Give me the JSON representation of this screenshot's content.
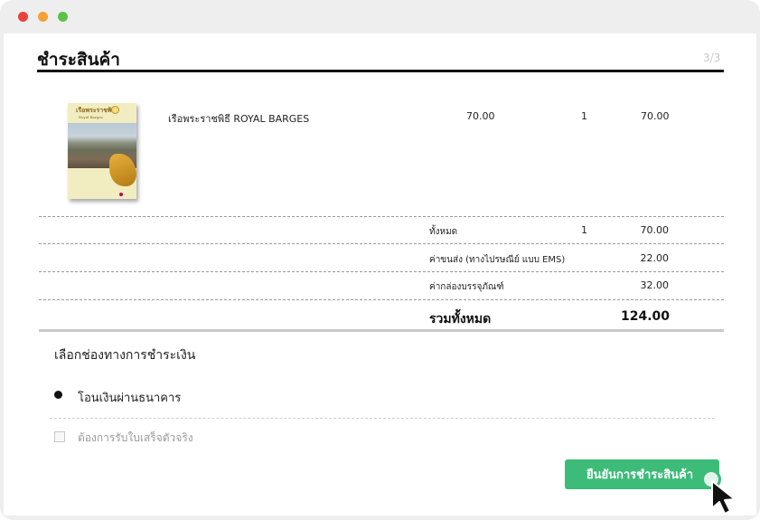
{
  "window": {
    "buttons": [
      "close",
      "minimize",
      "maximize"
    ]
  },
  "page": {
    "title": "ชำระสินค้า",
    "step": "3/3"
  },
  "cart": {
    "items": [
      {
        "image": "book-cover",
        "cover_title": "เรือพระราชพิธี",
        "cover_subtitle": "Royal Barges",
        "name": "เรือพระราชพิธี ROYAL BARGES",
        "price": "70.00",
        "qty": "1",
        "total": "70.00"
      }
    ]
  },
  "summary": {
    "subtotal_label": "ทั้งหมด",
    "subtotal_qty": "1",
    "subtotal_value": "70.00",
    "shipping_label": "ค่าขนส่ง (ทางไปรษณีย์ แบบ EMS)",
    "shipping_value": "22.00",
    "box_label": "ค่ากล่องบรรจุภัณฑ์",
    "box_value": "32.00",
    "grand_label": "รวมทั้งหมด",
    "grand_value": "124.00"
  },
  "payment": {
    "heading": "เลือกช่องทางการชำระเงิน",
    "options": [
      {
        "label": "โอนเงินผ่านธนาคาร",
        "selected": true
      }
    ],
    "receipt_checkbox": {
      "label": "ต้องการรับใบเสร็จตัวจริง",
      "checked": false
    }
  },
  "actions": {
    "confirm_label": "ยืนยันการชำระสินค้า"
  },
  "colors": {
    "accent": "#3dbb79",
    "window_bg": "#eeeeee",
    "close": "#ee3f3a",
    "minimize": "#f4a233",
    "maximize": "#5cc147"
  },
  "icons": {
    "cursor": "arrow-cursor-icon",
    "click": "click-indicator-icon"
  }
}
